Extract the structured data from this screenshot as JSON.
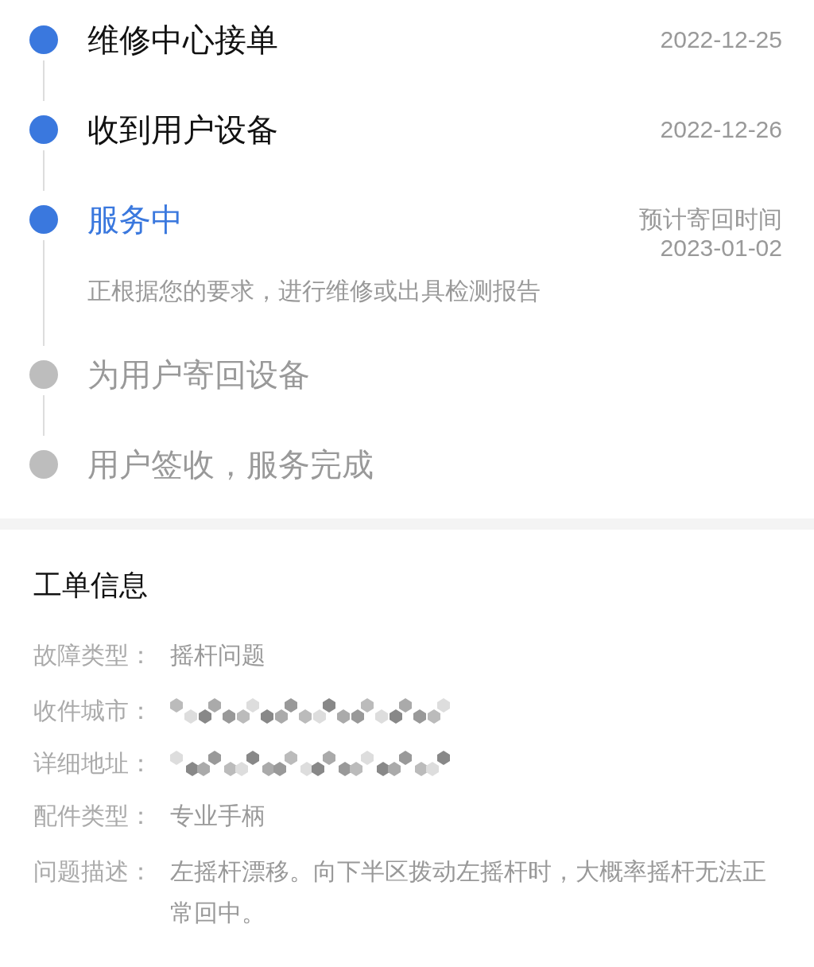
{
  "timeline": [
    {
      "title": "维修中心接单",
      "reached": true,
      "current": false,
      "date": "2022-12-25"
    },
    {
      "title": "收到用户设备",
      "reached": true,
      "current": false,
      "date": "2022-12-26"
    },
    {
      "title": "服务中",
      "reached": true,
      "current": true,
      "date_label": "预计寄回时间",
      "date": "2023-01-02",
      "description": "正根据您的要求，进行维修或出具检测报告"
    },
    {
      "title": "为用户寄回设备",
      "reached": false,
      "current": false
    },
    {
      "title": "用户签收，服务完成",
      "reached": false,
      "current": false
    }
  ],
  "order_info": {
    "title": "工单信息",
    "rows": [
      {
        "kind": "text",
        "label": "故障类型：",
        "value": "摇杆问题"
      },
      {
        "kind": "redacted",
        "label": "收件城市："
      },
      {
        "kind": "redacted",
        "label": "详细地址："
      },
      {
        "kind": "text",
        "label": "配件类型：",
        "value": "专业手柄"
      },
      {
        "kind": "text",
        "label": "问题描述：",
        "value": "左摇杆漂移。向下半区拨动左摇杆时，大概率摇杆无法正常回中。"
      }
    ]
  }
}
